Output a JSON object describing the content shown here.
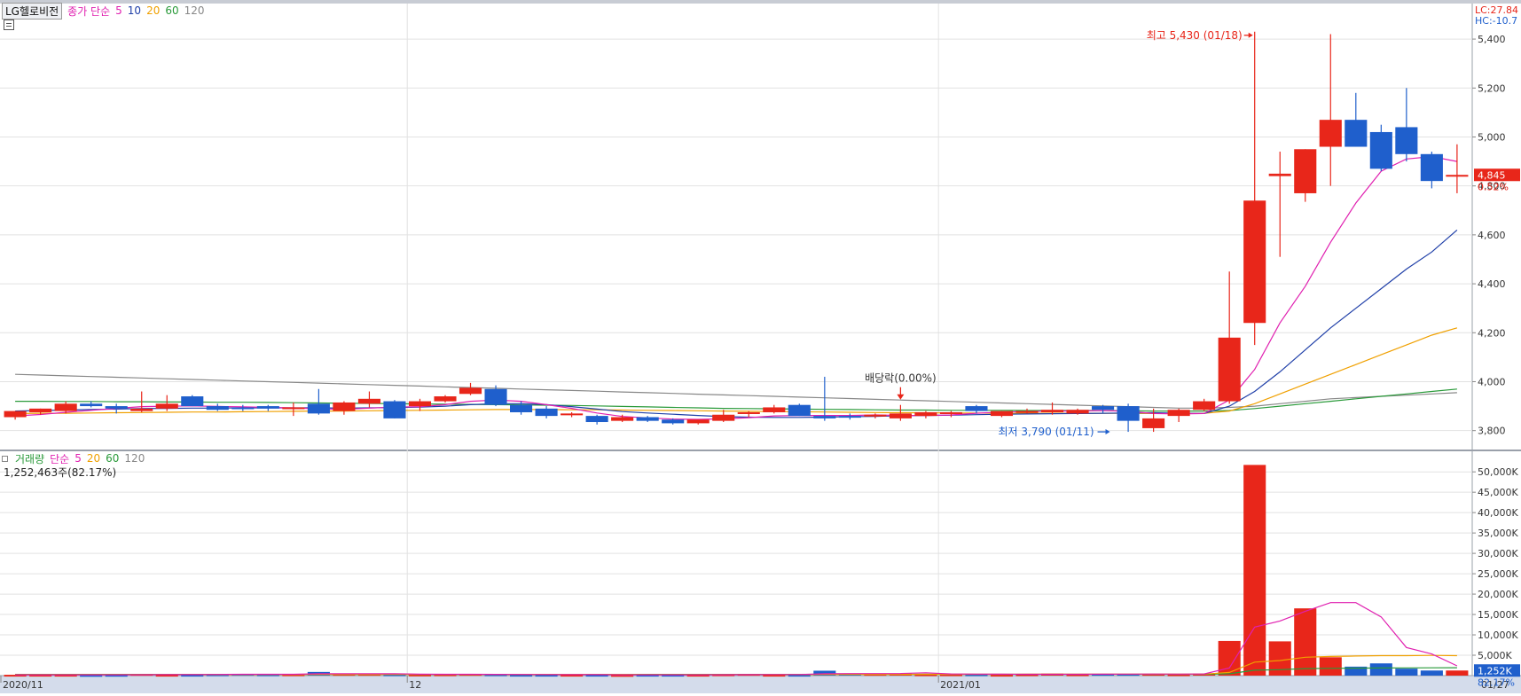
{
  "price_legend": {
    "stock": "LG헬로비전",
    "label": "종가 단순",
    "periods": [
      "5",
      "10",
      "20",
      "60",
      "120"
    ]
  },
  "volume_legend": {
    "label": "거래량",
    "label2": "단순",
    "periods": [
      "5",
      "20",
      "60",
      "120"
    ],
    "info": "1,252,463주(82.17%)"
  },
  "colors": {
    "up": "#e8261a",
    "down": "#1f5fcc",
    "ma5": "#e020b0",
    "ma10": "#1f3fa8",
    "ma20": "#f0a000",
    "ma60": "#2a9a3a",
    "ma120": "#888888"
  },
  "right_info": {
    "lc": "LC:27.84",
    "hc": "HC:-10.7",
    "price": "4,845",
    "change": "0.52%",
    "vol_tag": "1,252K",
    "vol_pct": "82.17%"
  },
  "annotations": {
    "high": "최고 5,430 (01/18)",
    "low": "최저 3,790 (01/11)",
    "dividend": "배당락(0.00%)"
  },
  "chart_data": [
    {
      "type": "candlestick",
      "ylim": [
        3730,
        5480
      ],
      "yticks": [
        "3,800",
        "4,000",
        "4,200",
        "4,400",
        "4,600",
        "4,800",
        "5,000",
        "5,200",
        "5,400"
      ],
      "x_tick_labels": [
        "2020/11",
        "12",
        "2021/01",
        "01/27"
      ],
      "candles": [
        {
          "o": 3855,
          "h": 3880,
          "l": 3845,
          "c": 3880
        },
        {
          "o": 3875,
          "h": 3890,
          "l": 3865,
          "c": 3890
        },
        {
          "o": 3880,
          "h": 3920,
          "l": 3870,
          "c": 3910
        },
        {
          "o": 3910,
          "h": 3920,
          "l": 3895,
          "c": 3900
        },
        {
          "o": 3900,
          "h": 3910,
          "l": 3870,
          "c": 3890
        },
        {
          "o": 3880,
          "h": 3960,
          "l": 3875,
          "c": 3890
        },
        {
          "o": 3890,
          "h": 3945,
          "l": 3880,
          "c": 3910
        },
        {
          "o": 3940,
          "h": 3945,
          "l": 3900,
          "c": 3900
        },
        {
          "o": 3900,
          "h": 3910,
          "l": 3880,
          "c": 3885
        },
        {
          "o": 3895,
          "h": 3905,
          "l": 3880,
          "c": 3890
        },
        {
          "o": 3900,
          "h": 3905,
          "l": 3880,
          "c": 3890
        },
        {
          "o": 3890,
          "h": 3915,
          "l": 3860,
          "c": 3895
        },
        {
          "o": 3910,
          "h": 3970,
          "l": 3865,
          "c": 3870
        },
        {
          "o": 3880,
          "h": 3920,
          "l": 3865,
          "c": 3915
        },
        {
          "o": 3910,
          "h": 3960,
          "l": 3895,
          "c": 3930
        },
        {
          "o": 3920,
          "h": 3925,
          "l": 3850,
          "c": 3850
        },
        {
          "o": 3900,
          "h": 3930,
          "l": 3880,
          "c": 3920
        },
        {
          "o": 3920,
          "h": 3945,
          "l": 3915,
          "c": 3940
        },
        {
          "o": 3950,
          "h": 3995,
          "l": 3945,
          "c": 3975
        },
        {
          "o": 3970,
          "h": 3985,
          "l": 3900,
          "c": 3905
        },
        {
          "o": 3905,
          "h": 3920,
          "l": 3865,
          "c": 3875
        },
        {
          "o": 3890,
          "h": 3900,
          "l": 3850,
          "c": 3860
        },
        {
          "o": 3865,
          "h": 3875,
          "l": 3855,
          "c": 3870
        },
        {
          "o": 3860,
          "h": 3865,
          "l": 3825,
          "c": 3835
        },
        {
          "o": 3840,
          "h": 3865,
          "l": 3835,
          "c": 3855
        },
        {
          "o": 3855,
          "h": 3860,
          "l": 3835,
          "c": 3840
        },
        {
          "o": 3845,
          "h": 3850,
          "l": 3825,
          "c": 3830
        },
        {
          "o": 3830,
          "h": 3845,
          "l": 3825,
          "c": 3845
        },
        {
          "o": 3840,
          "h": 3885,
          "l": 3835,
          "c": 3865
        },
        {
          "o": 3870,
          "h": 3880,
          "l": 3855,
          "c": 3875
        },
        {
          "o": 3875,
          "h": 3905,
          "l": 3870,
          "c": 3895
        },
        {
          "o": 3905,
          "h": 3910,
          "l": 3860,
          "c": 3860
        },
        {
          "o": 3860,
          "h": 4020,
          "l": 3840,
          "c": 3850
        },
        {
          "o": 3860,
          "h": 3870,
          "l": 3845,
          "c": 3855
        },
        {
          "o": 3860,
          "h": 3870,
          "l": 3850,
          "c": 3865
        },
        {
          "o": 3850,
          "h": 3905,
          "l": 3840,
          "c": 3870
        },
        {
          "o": 3860,
          "h": 3880,
          "l": 3850,
          "c": 3875
        },
        {
          "o": 3870,
          "h": 3880,
          "l": 3855,
          "c": 3875
        },
        {
          "o": 3900,
          "h": 3905,
          "l": 3870,
          "c": 3880
        },
        {
          "o": 3860,
          "h": 3880,
          "l": 3855,
          "c": 3880
        },
        {
          "o": 3875,
          "h": 3890,
          "l": 3870,
          "c": 3880
        },
        {
          "o": 3875,
          "h": 3915,
          "l": 3865,
          "c": 3885
        },
        {
          "o": 3870,
          "h": 3890,
          "l": 3865,
          "c": 3885
        },
        {
          "o": 3900,
          "h": 3905,
          "l": 3870,
          "c": 3885
        },
        {
          "o": 3900,
          "h": 3910,
          "l": 3795,
          "c": 3840
        },
        {
          "o": 3810,
          "h": 3890,
          "l": 3795,
          "c": 3850
        },
        {
          "o": 3860,
          "h": 3890,
          "l": 3835,
          "c": 3885
        },
        {
          "o": 3885,
          "h": 3930,
          "l": 3880,
          "c": 3920
        },
        {
          "o": 3920,
          "h": 4450,
          "l": 3910,
          "c": 4180
        },
        {
          "o": 4240,
          "h": 5430,
          "l": 4150,
          "c": 4740
        },
        {
          "o": 4840,
          "h": 4940,
          "l": 4510,
          "c": 4850
        },
        {
          "o": 4770,
          "h": 4950,
          "l": 4735,
          "c": 4950
        },
        {
          "o": 4960,
          "h": 5420,
          "l": 4800,
          "c": 5070
        },
        {
          "o": 5070,
          "h": 5180,
          "l": 4960,
          "c": 4960
        },
        {
          "o": 5020,
          "h": 5050,
          "l": 4860,
          "c": 4870
        },
        {
          "o": 5040,
          "h": 5200,
          "l": 4900,
          "c": 4930
        },
        {
          "o": 4930,
          "h": 4940,
          "l": 4790,
          "c": 4820
        },
        {
          "o": 4840,
          "h": 4970,
          "l": 4770,
          "c": 4845
        }
      ],
      "ma5": [
        3860,
        3866,
        3875,
        3883,
        3891,
        3898,
        3900,
        3901,
        3899,
        3897,
        3895,
        3893,
        3889,
        3887,
        3892,
        3896,
        3898,
        3906,
        3920,
        3925,
        3920,
        3906,
        3891,
        3872,
        3858,
        3852,
        3847,
        3846,
        3848,
        3853,
        3860,
        3862,
        3862,
        3862,
        3864,
        3862,
        3862,
        3864,
        3871,
        3876,
        3878,
        3880,
        3880,
        3882,
        3879,
        3870,
        3868,
        3870,
        3925,
        4050,
        4240,
        4390,
        4570,
        4730,
        4860,
        4910,
        4920,
        4900
      ],
      "ma10": [
        3880,
        3882,
        3884,
        3886,
        3888,
        3890,
        3891,
        3892,
        3892,
        3893,
        3893,
        3893,
        3893,
        3892,
        3893,
        3894,
        3896,
        3900,
        3906,
        3910,
        3910,
        3906,
        3898,
        3888,
        3878,
        3872,
        3867,
        3862,
        3857,
        3855,
        3854,
        3854,
        3855,
        3857,
        3858,
        3861,
        3862,
        3863,
        3865,
        3867,
        3868,
        3869,
        3870,
        3871,
        3872,
        3873,
        3871,
        3870,
        3900,
        3960,
        4040,
        4130,
        4220,
        4300,
        4380,
        4460,
        4530,
        4620
      ],
      "ma20": [
        3870,
        3871,
        3871,
        3872,
        3873,
        3874,
        3875,
        3876,
        3876,
        3877,
        3878,
        3879,
        3880,
        3880,
        3881,
        3882,
        3883,
        3884,
        3885,
        3886,
        3886,
        3886,
        3885,
        3885,
        3884,
        3883,
        3882,
        3881,
        3880,
        3879,
        3878,
        3877,
        3876,
        3875,
        3874,
        3873,
        3873,
        3872,
        3872,
        3871,
        3871,
        3871,
        3871,
        3871,
        3871,
        3870,
        3870,
        3871,
        3880,
        3910,
        3950,
        3990,
        4030,
        4070,
        4110,
        4150,
        4190,
        4220
      ],
      "ma60": [
        3920,
        3920,
        3919,
        3919,
        3918,
        3918,
        3917,
        3917,
        3916,
        3916,
        3915,
        3914,
        3913,
        3912,
        3911,
        3910,
        3909,
        3908,
        3907,
        3906,
        3905,
        3904,
        3903,
        3901,
        3899,
        3897,
        3895,
        3893,
        3891,
        3890,
        3889,
        3888,
        3887,
        3886,
        3885,
        3884,
        3884,
        3883,
        3883,
        3883,
        3882,
        3882,
        3882,
        3882,
        3881,
        3880,
        3880,
        3880,
        3882,
        3890,
        3900,
        3910,
        3920,
        3930,
        3940,
        3950,
        3960,
        3970
      ],
      "ma120": [
        4030,
        4027,
        4024,
        4021,
        4018,
        4015,
        4012,
        4009,
        4006,
        4003,
        4000,
        3997,
        3994,
        3991,
        3988,
        3985,
        3982,
        3979,
        3976,
        3973,
        3970,
        3967,
        3964,
        3961,
        3958,
        3955,
        3952,
        3949,
        3946,
        3943,
        3940,
        3937,
        3934,
        3931,
        3928,
        3925,
        3922,
        3919,
        3916,
        3913,
        3910,
        3907,
        3904,
        3901,
        3898,
        3895,
        3892,
        3892,
        3895,
        3900,
        3910,
        3920,
        3930,
        3935,
        3940,
        3945,
        3950,
        3955
      ]
    },
    {
      "type": "bar",
      "ylim": [
        0,
        52000
      ],
      "yticks": [
        "5,000K",
        "10,000K",
        "15,000K",
        "20,000K",
        "25,000K",
        "30,000K",
        "35,000K",
        "40,000K",
        "45,000K",
        "50,000K"
      ],
      "volume": [
        200,
        200,
        200,
        150,
        180,
        400,
        200,
        200,
        300,
        400,
        300,
        300,
        900,
        400,
        400,
        300,
        250,
        300,
        400,
        300,
        200,
        200,
        200,
        200,
        150,
        200,
        200,
        200,
        300,
        400,
        200,
        200,
        1200,
        500,
        400,
        500,
        300,
        300,
        300,
        200,
        300,
        500,
        300,
        400,
        400,
        400,
        300,
        500,
        8500,
        51700,
        8400,
        16500,
        4500,
        2200,
        3000,
        1700,
        1250,
        1250
      ],
      "ma5_vol": [
        200,
        200,
        200,
        190,
        190,
        220,
        230,
        240,
        280,
        320,
        330,
        320,
        450,
        460,
        460,
        470,
        350,
        320,
        320,
        310,
        290,
        260,
        250,
        230,
        200,
        190,
        190,
        190,
        210,
        250,
        260,
        260,
        460,
        490,
        510,
        530,
        700,
        420,
        380,
        340,
        320,
        320,
        320,
        340,
        380,
        400,
        380,
        420,
        1900,
        11900,
        13400,
        15800,
        17900,
        17900,
        14400,
        6900,
        5300,
        2400
      ],
      "ma20_vol": [
        230,
        230,
        230,
        230,
        230,
        230,
        240,
        240,
        250,
        260,
        260,
        270,
        300,
        310,
        310,
        310,
        310,
        310,
        310,
        310,
        310,
        300,
        290,
        290,
        280,
        270,
        260,
        250,
        250,
        250,
        250,
        240,
        300,
        300,
        300,
        310,
        320,
        330,
        330,
        330,
        340,
        350,
        350,
        350,
        360,
        360,
        360,
        380,
        780,
        3300,
        3700,
        4500,
        4700,
        4800,
        4900,
        4900,
        4950,
        4900
      ],
      "ma60_vol": [
        300,
        300,
        300,
        300,
        300,
        300,
        300,
        300,
        300,
        300,
        300,
        300,
        310,
        310,
        310,
        310,
        310,
        310,
        310,
        310,
        310,
        310,
        310,
        310,
        310,
        310,
        310,
        310,
        310,
        310,
        310,
        310,
        320,
        320,
        320,
        320,
        320,
        320,
        320,
        320,
        320,
        320,
        320,
        320,
        320,
        320,
        320,
        320,
        460,
        1320,
        1450,
        1720,
        1790,
        1820,
        1870,
        1890,
        1910,
        1930
      ]
    }
  ]
}
